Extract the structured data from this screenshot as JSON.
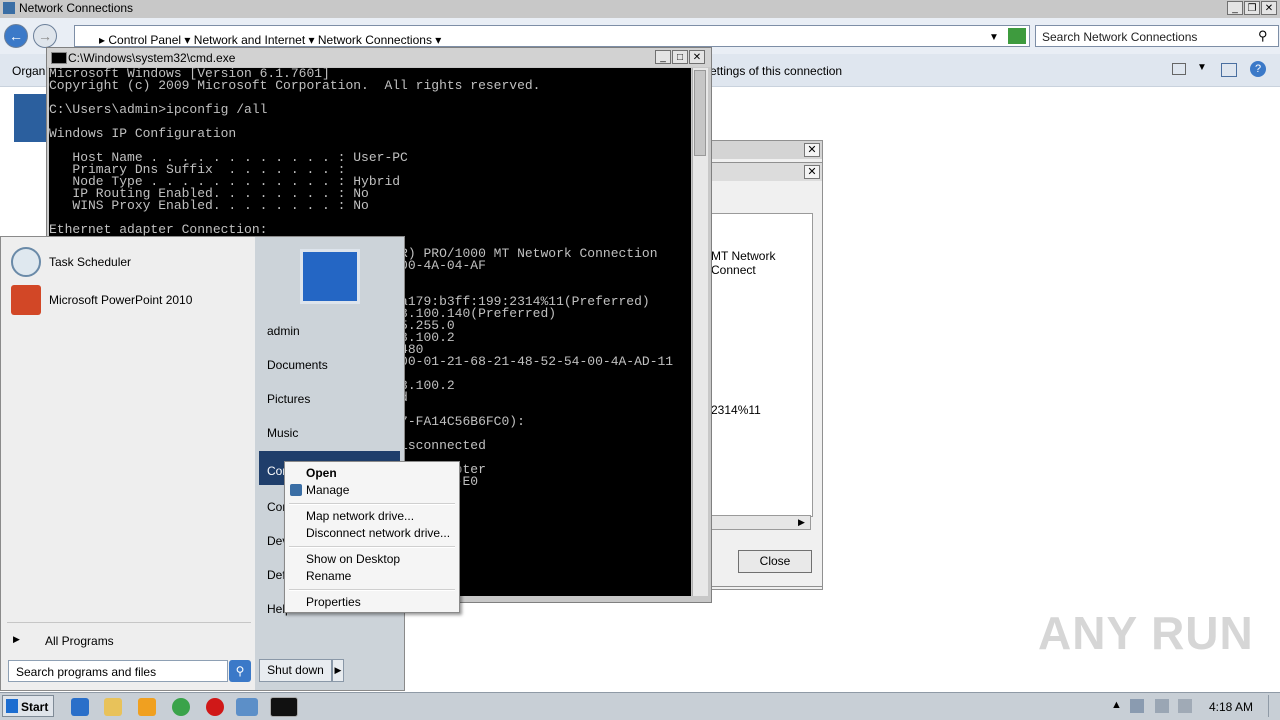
{
  "explorer": {
    "title": "Network Connections",
    "breadcrumb": [
      "Control Panel",
      "Network and Internet",
      "Network Connections"
    ],
    "search_placeholder": "Search Network Connections",
    "cmdbar_left": "Organi",
    "cmdbar_right": "ettings of this connection"
  },
  "cmd": {
    "title": "C:\\Windows\\system32\\cmd.exe",
    "lines": [
      "Microsoft Windows [Version 6.1.7601]",
      "Copyright (c) 2009 Microsoft Corporation.  All rights reserved.",
      "",
      "C:\\Users\\admin>ipconfig /all",
      "",
      "Windows IP Configuration",
      "",
      "   Host Name . . . . . . . . . . . . : User-PC",
      "   Primary Dns Suffix  . . . . . . . :",
      "   Node Type . . . . . . . . . . . . : Hybrid",
      "   IP Routing Enabled. . . . . . . . : No",
      "   WINS Proxy Enabled. . . . . . . . : No",
      "",
      "Ethernet adapter Connection:",
      "",
      "                                            (R) PRO/1000 MT Network Connection",
      "                                            -00-4A-04-AF",
      "",
      "",
      "                                            :a179:b3ff:199:2314%11(Preferred)",
      "                                            58.100.140(Preferred)",
      "                                            55.255.0",
      "                                            58.100.2",
      "                                            5480",
      "                                            -00-01-21-68-21-48-52-54-00-4A-AD-11",
      "",
      "                                            58.100.2",
      "                                            ed",
      "",
      "                                            07-FA14C56B6FC0):",
      "",
      "                                            disconnected",
      "",
      "                                            ATAP Adapter",
      "                                            00-00-00-E0"
    ]
  },
  "dialog": {
    "fragment_1": "MT Network Connect",
    "fragment_2": "2314%11",
    "close_label": "Close"
  },
  "start_menu": {
    "left_items": [
      "Task Scheduler",
      "Microsoft PowerPoint 2010"
    ],
    "all_programs": "All Programs",
    "search_placeholder": "Search programs and files",
    "right_items": [
      "admin",
      "Documents",
      "Pictures",
      "Music",
      "Con",
      "Con",
      "Dev",
      "Def",
      "Help"
    ],
    "shutdown": "Shut down"
  },
  "context_menu": {
    "items": [
      "Open",
      "Manage",
      "Map network drive...",
      "Disconnect network drive...",
      "Show on Desktop",
      "Rename",
      "Properties"
    ]
  },
  "taskbar": {
    "start": "Start",
    "clock": "4:18 AM"
  },
  "watermark": "ANY RUN"
}
